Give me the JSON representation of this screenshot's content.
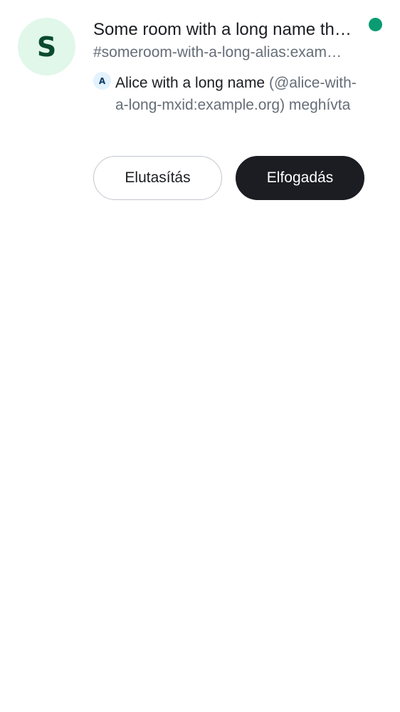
{
  "invite": {
    "room_avatar_letter": "S",
    "room_name": "Some room with a long name that does not fit",
    "room_alias": "#someroom-with-a-long-alias:example.org",
    "inviter_avatar_letter": "A",
    "inviter_name": "Alice with a long name",
    "inviter_detail": " (@alice-with-a-long-mxid:example.org) meghívta",
    "decline_label": "Elutasítás",
    "accept_label": "Elfogadás"
  },
  "colors": {
    "unread_dot": "#0a9b73",
    "room_avatar_bg": "#e0f7ea",
    "accept_bg": "#1b1d22"
  }
}
